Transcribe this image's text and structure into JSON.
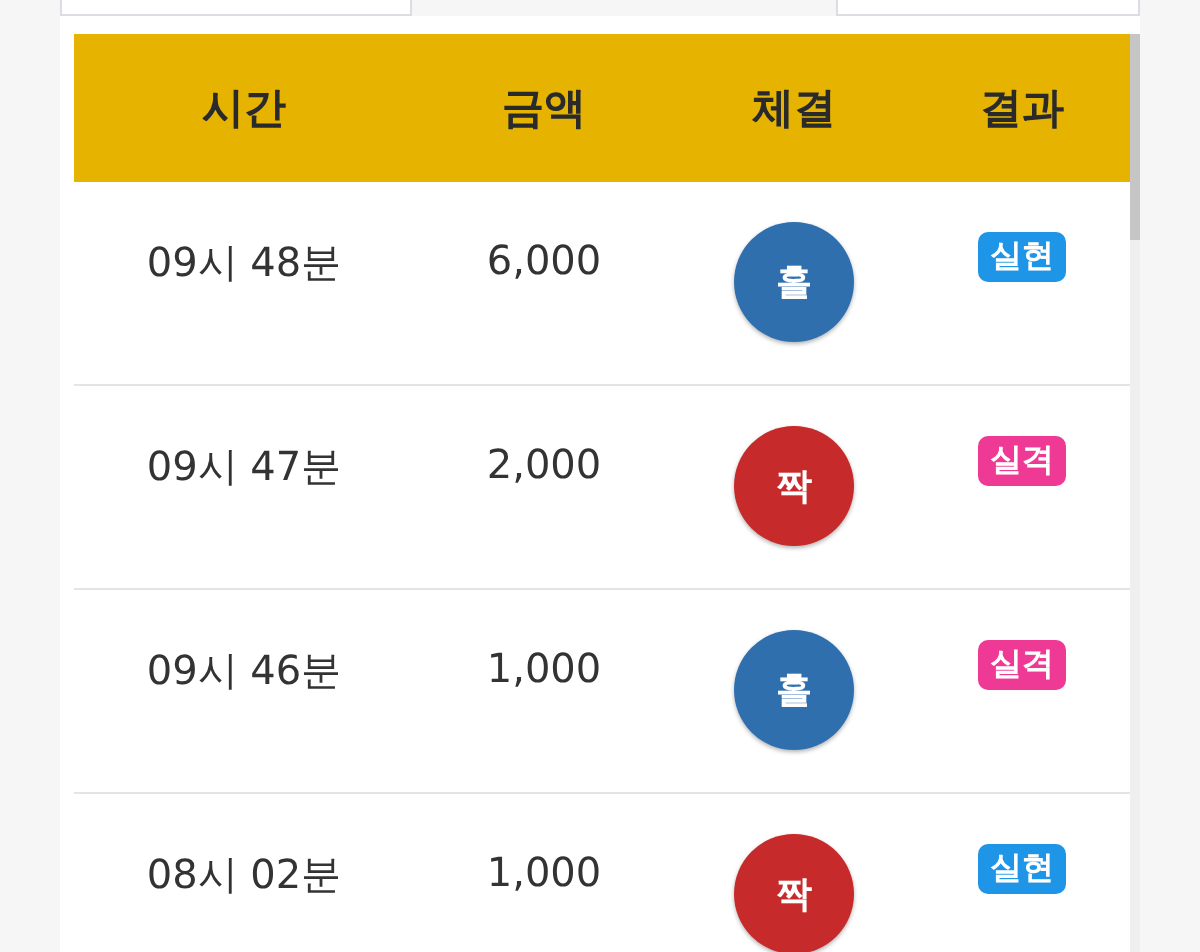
{
  "columns": [
    "시간",
    "금액",
    "체결",
    "결과"
  ],
  "rows": [
    {
      "time": "09시 48분",
      "amount": "6,000",
      "bet": {
        "kind": "odd",
        "label": "홀"
      },
      "result": {
        "kind": "win",
        "label": "실현"
      }
    },
    {
      "time": "09시 47분",
      "amount": "2,000",
      "bet": {
        "kind": "even",
        "label": "짝"
      },
      "result": {
        "kind": "lose",
        "label": "실격"
      }
    },
    {
      "time": "09시 46분",
      "amount": "1,000",
      "bet": {
        "kind": "odd",
        "label": "홀"
      },
      "result": {
        "kind": "lose",
        "label": "실격"
      }
    },
    {
      "time": "08시 02분",
      "amount": "1,000",
      "bet": {
        "kind": "even",
        "label": "짝"
      },
      "result": {
        "kind": "win",
        "label": "실현"
      }
    }
  ]
}
